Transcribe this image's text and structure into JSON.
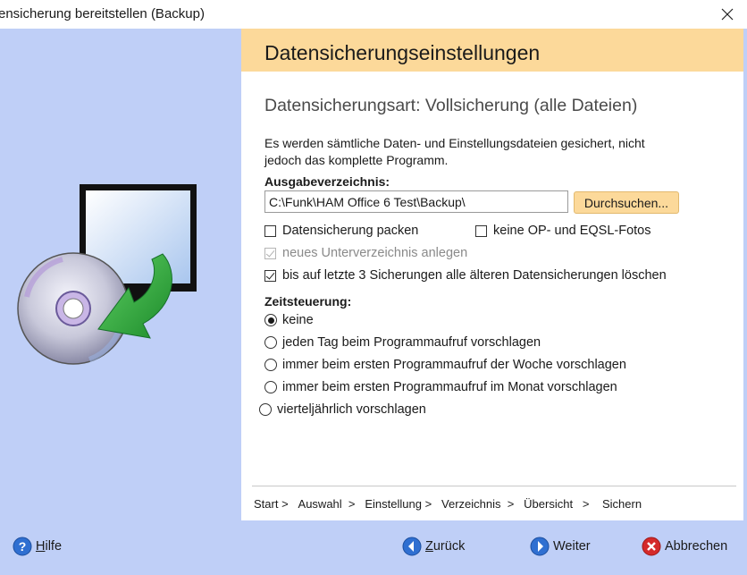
{
  "window": {
    "title": "ensicherung bereitstellen (Backup)"
  },
  "header": {
    "title": "Datensicherungseinstellungen"
  },
  "main": {
    "subtitle": "Datensicherungsart: Vollsicherung (alle Dateien)",
    "description": "Es werden sämtliche Daten- und Einstellungsdateien gesichert, nicht jedoch das komplette Programm.",
    "output_dir_label": "Ausgabeverzeichnis:",
    "output_dir_value": "C:\\Funk\\HAM Office 6 Test\\Backup\\",
    "browse_label": "Durchsuchen...",
    "options": {
      "pack": {
        "label": "Datensicherung packen",
        "checked": false
      },
      "no_op_fotos": {
        "label": "keine OP- und EQSL-Fotos",
        "checked": false
      },
      "new_subdir": {
        "label": "neues Unterverzeichnis anlegen",
        "checked": true,
        "enabled": false
      },
      "keep_last": {
        "label": "bis auf letzte 3 Sicherungen alle älteren Datensicherungen löschen",
        "checked": true
      }
    },
    "schedule_label": "Zeitsteuerung:",
    "schedule_options": [
      {
        "label": "keine",
        "selected": true
      },
      {
        "label": "jeden Tag beim Programmaufruf vorschlagen",
        "selected": false
      },
      {
        "label": "immer beim ersten Programmaufruf der Woche vorschlagen",
        "selected": false
      },
      {
        "label": "immer beim ersten Programmaufruf im Monat vorschlagen",
        "selected": false
      },
      {
        "label": "vierteljährlich vorschlagen",
        "selected": false
      }
    ]
  },
  "breadcrumb": [
    "Start",
    "Auswahl",
    "Einstellung",
    "Verzeichnis",
    "Übersicht",
    "Sichern"
  ],
  "footer": {
    "help": {
      "prefix": "H",
      "rest": "ilfe"
    },
    "back": {
      "prefix": "Z",
      "rest": "urück"
    },
    "next": "Weiter",
    "cancel": "Abbrechen"
  },
  "colors": {
    "side_panel": "#bfcff7",
    "header_band": "#fcd99a",
    "accent_blue": "#2f6fd1",
    "cancel_red": "#d42a2a",
    "arrow_green": "#2e9e3a"
  },
  "icons": {
    "help": "help-icon",
    "back": "back-arrow-icon",
    "next": "next-arrow-icon",
    "cancel": "cancel-icon",
    "close": "close-icon",
    "illustration": "backup-cd-monitor-icon"
  }
}
